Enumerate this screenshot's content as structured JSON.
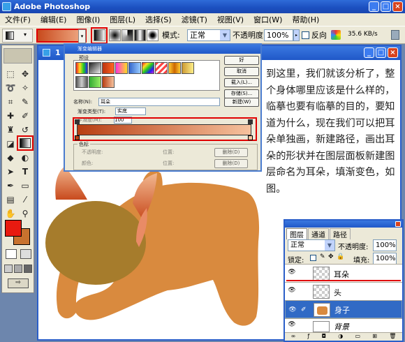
{
  "app": {
    "title": "Adobe Photoshop"
  },
  "menu": [
    "文件(F)",
    "编辑(E)",
    "图像(I)",
    "图层(L)",
    "选择(S)",
    "滤镜(T)",
    "视图(V)",
    "窗口(W)",
    "帮助(H)"
  ],
  "options": {
    "mode_label": "模式:",
    "mode_value": "正常",
    "opacity_label": "不透明度:",
    "opacity_value": "100%",
    "reverse_label": "反向",
    "status": "35.6 KB/s"
  },
  "document": {
    "title": "1"
  },
  "gradient_editor": {
    "title": "渐变编辑器",
    "presets_label": "预设",
    "ok": "好",
    "cancel": "取消",
    "load": "载入(L)...",
    "save": "存储(S)...",
    "name_label": "名称(N):",
    "name_value": "耳朵",
    "new_button": "新建(W)",
    "type_label": "渐变类型(T):",
    "type_value": "实底",
    "smooth_label": "平滑度(M):",
    "smooth_value": "100",
    "stops_label": "色标",
    "opacity_label": "不透明度:",
    "location_label": "位置:",
    "delete_label": "删除(D)",
    "color_label": "颜色:",
    "colors": {
      "start": "#b83e12",
      "end": "#f6c29e"
    }
  },
  "tutorial_text": "到这里，我们就该分析了，整个身体哪里应该是什么样的，临摹也要有临摹的目的，要知道为什么，现在我们可以把耳朵单独画，新建路径，画出耳朵的形状并在图层面板新建图层命名为耳朵，填渐变色，如图。",
  "layers_panel": {
    "tabs": [
      "图层",
      "通道",
      "路径"
    ],
    "blend_mode": "正常",
    "opacity_label": "不透明度:",
    "opacity_value": "100%",
    "lock_label": "锁定:",
    "fill_label": "填充:",
    "fill_value": "100%",
    "layers": [
      {
        "name": "耳朵",
        "selected": false
      },
      {
        "name": "头",
        "selected": false
      },
      {
        "name": "身子",
        "selected": true
      },
      {
        "name": "背景",
        "selected": false
      }
    ]
  },
  "colors": {
    "foreground": "#e81a10",
    "background": "#c8722e",
    "body": "#d98a3e",
    "head": "#a67c2c",
    "highlight": "#e00000"
  }
}
